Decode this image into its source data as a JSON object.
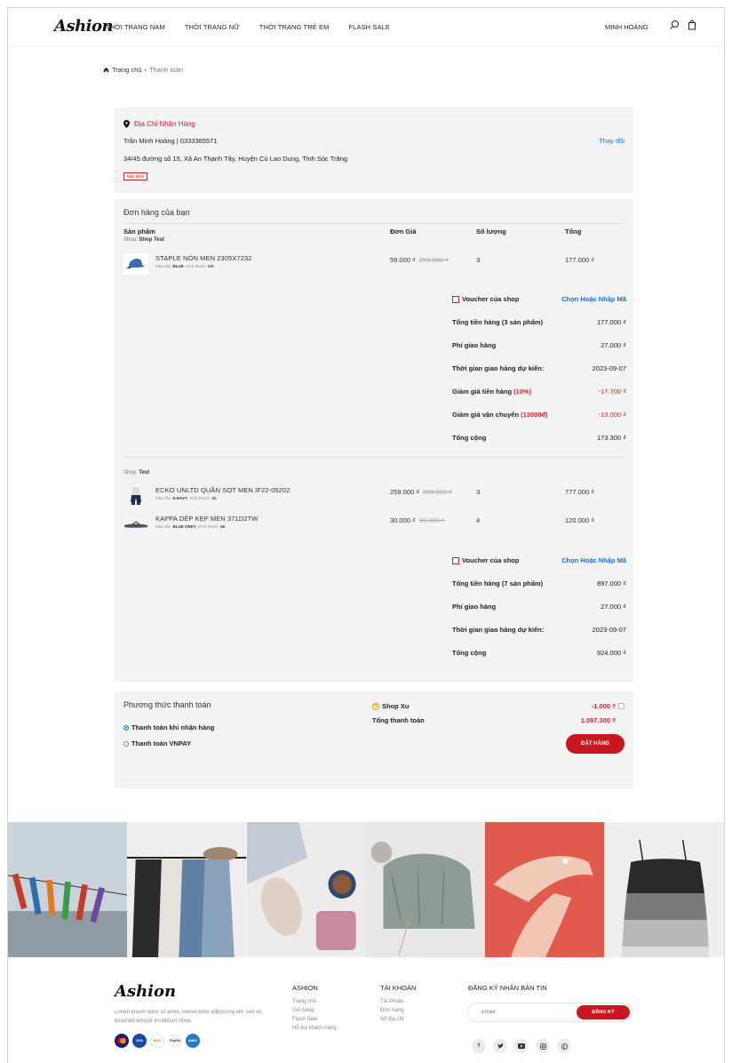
{
  "header": {
    "logo": "Ashion",
    "nav": [
      "THỜI TRANG NAM",
      "THỜI TRANG NỮ",
      "THỜI TRANG TRẺ EM",
      "FLASH SALE"
    ],
    "user": "MINH HOÀNG"
  },
  "breadcrumb": {
    "home": "Trang chủ",
    "current": "Thanh toán"
  },
  "address": {
    "title": "Địa Chỉ Nhận Hàng",
    "name": "Trần Minh Hoàng | 0333365571",
    "line": "34/45 đường số 15, Xã An Thạnh Tây, Huyện Cù Lao Dung, Tỉnh Sóc Trăng",
    "badge": "Mặc Định",
    "change": "Thay đổi"
  },
  "order": {
    "title": "Đơn hàng của bạn",
    "columns": [
      "Sản phẩm",
      "Đơn Giá",
      "Số lượng",
      "Tổng"
    ],
    "shops": [
      {
        "shop_prefix": "Shop:",
        "shop_name": "Shop Test",
        "products": [
          {
            "name": "STAPLE NÓN MEN 2305X7232",
            "color_label": "Màu sắc:",
            "color": "BLUE",
            "size_label": ", Kích thước:",
            "size": "OS",
            "price": "59.000 ₫",
            "old_price": "299.000 ₫",
            "qty": "3",
            "total": "177.000 ₫"
          }
        ],
        "voucher_label": "Voucher của shop",
        "voucher_action": "Chọn Hoặc Nhập Mã",
        "summary": {
          "subtotal_label": "Tổng tiền hàng (3 sản phẩm)",
          "subtotal": "177.000 ₫",
          "shipping_label": "Phí giao hàng",
          "shipping": "27.000 ₫",
          "delivery_label": "Thời gian giao hàng dự kiến:",
          "delivery": "2023-09-07",
          "discount_label": "Giảm giá tiền hàng",
          "discount_pct": "(10%)",
          "discount": "-17.700 ₫",
          "ship_discount_label": "Giảm giá vận chuyển",
          "ship_discount_amt": "(13000đ)",
          "ship_discount": "-13.000 ₫",
          "total_label": "Tổng cộng",
          "total": "173.300 ₫"
        }
      },
      {
        "shop_prefix": "Shop:",
        "shop_name": "Test",
        "products": [
          {
            "name": "ECKO UNLTD QUẦN SỌT MEN IF22-05202",
            "color_label": "Màu sắc:",
            "color": "D.NAVY",
            "size_label": ", Kích thước:",
            "size": "XL",
            "price": "259.000 ₫",
            "old_price": "699.000 ₫",
            "qty": "3",
            "total": "777.000 ₫"
          },
          {
            "name": "KAPPA DÉP KẸP MEN 371D2TW",
            "color_label": "Màu sắc:",
            "color": "BLUE GREY",
            "size_label": ", Kích thước:",
            "size": "39",
            "price": "30.000 ₫",
            "old_price": "99.000 ₫",
            "qty": "4",
            "total": "120.000 ₫"
          }
        ],
        "voucher_label": "Voucher của shop",
        "voucher_action": "Chọn Hoặc Nhập Mã",
        "summary": {
          "subtotal_label": "Tổng tiền hàng (7 sản phẩm)",
          "subtotal": "897.000 ₫",
          "shipping_label": "Phí giao hàng",
          "shipping": "27.000 ₫",
          "delivery_label": "Thời gian giao hàng dự kiến:",
          "delivery": "2023-09-07",
          "total_label": "Tổng cộng",
          "total": "924.000 ₫"
        }
      }
    ]
  },
  "payment": {
    "title": "Phương thức thanh toán",
    "options": [
      "Thanh toán khi nhận hàng",
      "Thanh toán VNPAY"
    ],
    "xu_label": "Shop Xu",
    "xu_value": "-1.000 ₫",
    "total_label": "Tổng thanh toán",
    "total": "1.097.300 ₫",
    "button": "ĐẶT HÀNG"
  },
  "footer": {
    "logo": "Ashion",
    "desc": "Lorem ipsum dolor sit amet, consectetur adipiscing elit, sed do eiusmod tempor incididunt cilisis.",
    "payment_logos": [
      "mastercard-icon",
      "visa-icon",
      "discover-icon",
      "paypal-icon",
      "amex-icon"
    ],
    "col1": {
      "heading": "ASHION",
      "links": [
        "Trang chủ",
        "Giỏ hàng",
        "Flash Sale",
        "Hỗ trợ khách hàng"
      ]
    },
    "col2": {
      "heading": "TÀI KHOẢN",
      "links": [
        "Tài khoản",
        "Đơn hàng",
        "Sổ địa chỉ"
      ]
    },
    "newsletter": {
      "heading": "ĐĂNG KÝ NHẬN BẢN TIN",
      "placeholder": "Email",
      "button": "ĐĂNG KÝ"
    },
    "socials": [
      "facebook-icon",
      "twitter-icon",
      "youtube-icon",
      "instagram-icon",
      "pinterest-icon"
    ]
  },
  "colors": {
    "accent_red": "#c8171e",
    "link_blue": "#1d6fd1",
    "panel_bg": "#f3f3f3"
  }
}
